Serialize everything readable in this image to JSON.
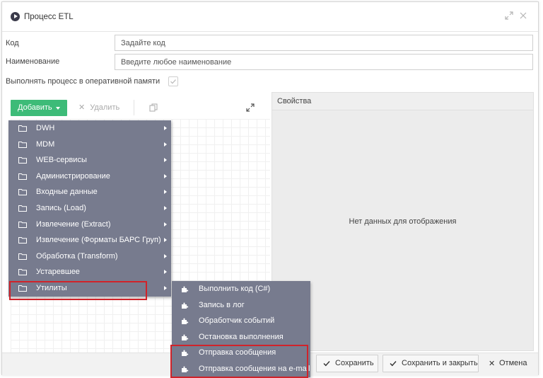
{
  "window": {
    "title": "Процесс ETL"
  },
  "form": {
    "code_label": "Код",
    "code_placeholder": "Задайте код",
    "name_label": "Наименование",
    "name_placeholder": "Введите любое наименование",
    "inmemory_label": "Выполнять процесс в оперативной памяти",
    "inmemory_checked": true
  },
  "toolbar": {
    "add_label": "Добавить",
    "delete_label": "Удалить"
  },
  "properties": {
    "header": "Свойства",
    "empty_text": "Нет данных для отображения"
  },
  "menu": {
    "items": [
      {
        "label": "DWH",
        "has_submenu": true
      },
      {
        "label": "MDM",
        "has_submenu": true
      },
      {
        "label": "WEB-сервисы",
        "has_submenu": true
      },
      {
        "label": "Администрирование",
        "has_submenu": true
      },
      {
        "label": "Входные данные",
        "has_submenu": true
      },
      {
        "label": "Запись (Load)",
        "has_submenu": true
      },
      {
        "label": "Извлечение (Extract)",
        "has_submenu": true
      },
      {
        "label": "Извлечение (Форматы БАРС Груп)",
        "has_submenu": true
      },
      {
        "label": "Обработка (Transform)",
        "has_submenu": true
      },
      {
        "label": "Устаревшее",
        "has_submenu": true
      },
      {
        "label": "Утилиты",
        "has_submenu": true,
        "highlighted": true
      }
    ]
  },
  "submenu": {
    "items": [
      {
        "label": "Выполнить код (C#)"
      },
      {
        "label": "Запись в лог"
      },
      {
        "label": "Обработчик событий"
      },
      {
        "label": "Остановка выполнения"
      },
      {
        "label": "Отправка сообщения",
        "highlighted": true
      },
      {
        "label": "Отправка сообщения на e-mail",
        "highlighted": true
      }
    ]
  },
  "footer": {
    "save_label": "Сохранить",
    "save_close_label": "Сохранить и закрыть",
    "cancel_label": "Отмена"
  },
  "colors": {
    "accent_green": "#3dbb78",
    "menu_bg": "#777b8e",
    "highlight_red": "#d0232a"
  },
  "icons": {
    "title": "play-circle-icon",
    "maximize": "maximize-icon",
    "close": "close-icon",
    "folder": "folder-icon",
    "plugin": "puzzle-icon",
    "copy": "copy-icon",
    "expand": "expand-icon",
    "check": "check-icon"
  }
}
